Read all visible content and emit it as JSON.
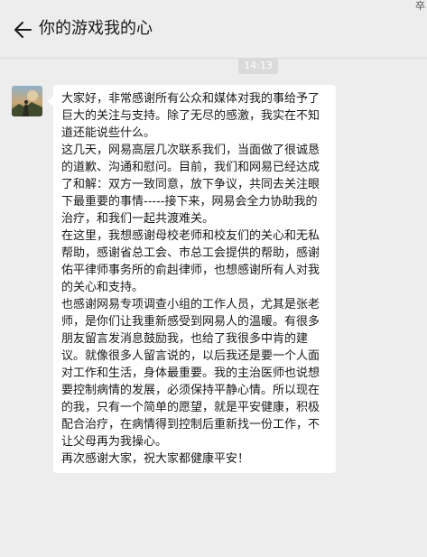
{
  "header": {
    "title": "你的游戏我的心",
    "back_icon": "arrow-left-icon",
    "corner_glyph": "卒"
  },
  "timestamp": "14:13",
  "message": {
    "avatar": "avatar-image",
    "paragraphs": [
      "大家好，非常感谢所有公众和媒体对我的事给予了巨大的关注与支持。除了无尽的感激，我实在不知道还能说些什么。",
      "这几天，网易高层几次联系我们，当面做了很诚恳的道歉、沟通和慰问。目前，我们和网易已经达成了和解：双方一致同意，放下争议，共同去关注眼下最重要的事情-----接下来，网易会全力协助我的治疗，和我们一起共渡难关。",
      "在这里，我想感谢母校老师和校友们的关心和无私帮助，感谢省总工会、市总工会提供的帮助，感谢佑平律师事务所的俞赳律师，也想感谢所有人对我的关心和支持。",
      "也感谢网易专项调查小组的工作人员，尤其是张老师，是你们让我重新感受到网易人的温暖。有很多朋友留言发消息鼓励我，也给了我很多中肯的建议。就像很多人留言说的，以后我还是要一个人面对工作和生活，身体最重要。我的主治医师也说想要控制病情的发展，必须保持平静心情。所以现在的我，只有一个简单的愿望，就是平安健康，积极配合治疗，在病情得到控制后重新找一份工作，不让父母再为我操心。",
      "再次感谢大家，祝大家都健康平安！"
    ]
  },
  "colors": {
    "background": "#ededed",
    "bubble": "#ffffff",
    "text": "#191919",
    "timestamp_bg": "#dadada"
  }
}
